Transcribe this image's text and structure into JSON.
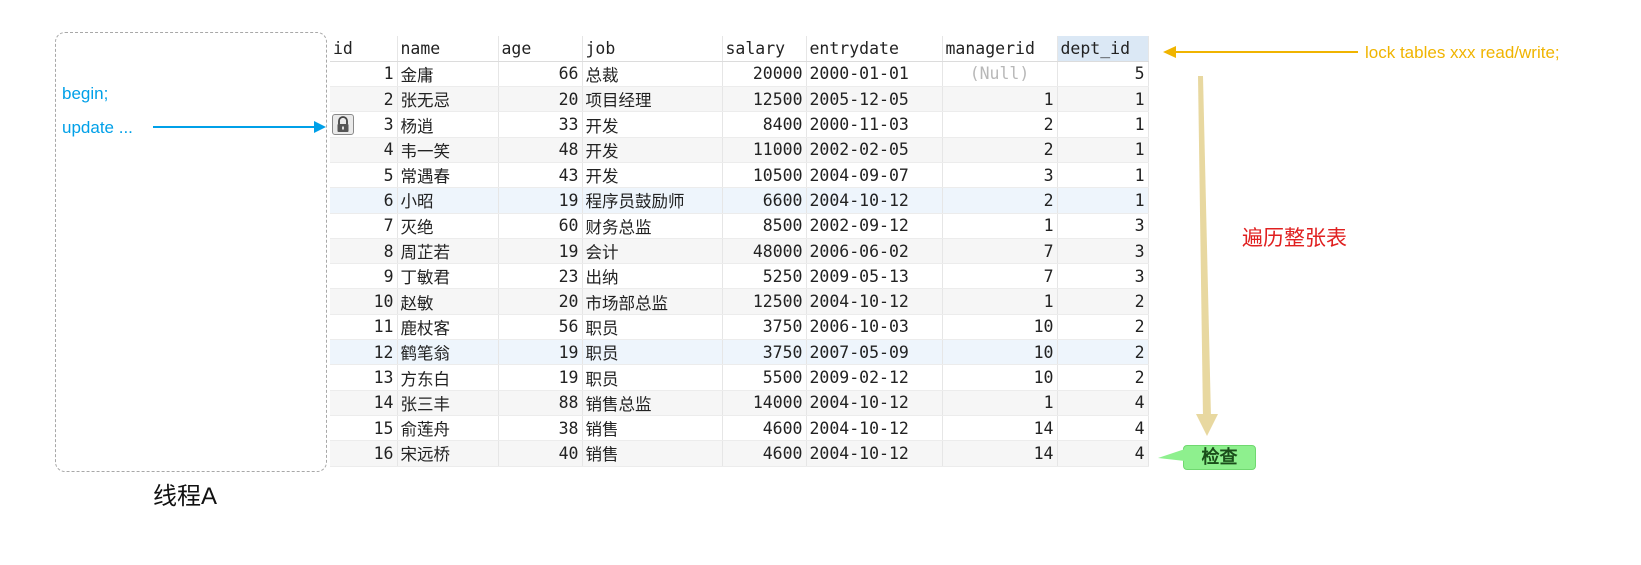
{
  "thread": {
    "label": "线程A",
    "code_lines": [
      "begin;",
      "update ..."
    ]
  },
  "table": {
    "columns": [
      "id",
      "name",
      "age",
      "job",
      "salary",
      "entrydate",
      "managerid",
      "dept_id"
    ],
    "selected_column": "dept_id",
    "locked_row_id": "3",
    "rows": [
      [
        "1",
        "金庸",
        "66",
        "总裁",
        "20000",
        "2000-01-01",
        "(Null)",
        "5"
      ],
      [
        "2",
        "张无忌",
        "20",
        "项目经理",
        "12500",
        "2005-12-05",
        "1",
        "1"
      ],
      [
        "3",
        "杨逍",
        "33",
        "开发",
        "8400",
        "2000-11-03",
        "2",
        "1"
      ],
      [
        "4",
        "韦一笑",
        "48",
        "开发",
        "11000",
        "2002-02-05",
        "2",
        "1"
      ],
      [
        "5",
        "常遇春",
        "43",
        "开发",
        "10500",
        "2004-09-07",
        "3",
        "1"
      ],
      [
        "6",
        "小昭",
        "19",
        "程序员鼓励师",
        "6600",
        "2004-10-12",
        "2",
        "1"
      ],
      [
        "7",
        "灭绝",
        "60",
        "财务总监",
        "8500",
        "2002-09-12",
        "1",
        "3"
      ],
      [
        "8",
        "周芷若",
        "19",
        "会计",
        "48000",
        "2006-06-02",
        "7",
        "3"
      ],
      [
        "9",
        "丁敏君",
        "23",
        "出纳",
        "5250",
        "2009-05-13",
        "7",
        "3"
      ],
      [
        "10",
        "赵敏",
        "20",
        "市场部总监",
        "12500",
        "2004-10-12",
        "1",
        "2"
      ],
      [
        "11",
        "鹿杖客",
        "56",
        "职员",
        "3750",
        "2006-10-03",
        "10",
        "2"
      ],
      [
        "12",
        "鹤笔翁",
        "19",
        "职员",
        "3750",
        "2007-05-09",
        "10",
        "2"
      ],
      [
        "13",
        "方东白",
        "19",
        "职员",
        "5500",
        "2009-02-12",
        "10",
        "2"
      ],
      [
        "14",
        "张三丰",
        "88",
        "销售总监",
        "14000",
        "2004-10-12",
        "1",
        "4"
      ],
      [
        "15",
        "俞莲舟",
        "38",
        "销售",
        "4600",
        "2004-10-12",
        "14",
        "4"
      ],
      [
        "16",
        "宋远桥",
        "40",
        "销售",
        "4600",
        "2004-10-12",
        "14",
        "4"
      ]
    ]
  },
  "annotations": {
    "lock_statement": "lock tables xxx read/write;",
    "scan_label": "遍历整张表",
    "check_label": "检查"
  },
  "colors": {
    "code_blue": "#00a0e8",
    "lock_yellow": "#f0b400",
    "scan_red": "#e02020",
    "scan_arrow": "#e8d8a0",
    "check_green": "#8ef08e"
  }
}
